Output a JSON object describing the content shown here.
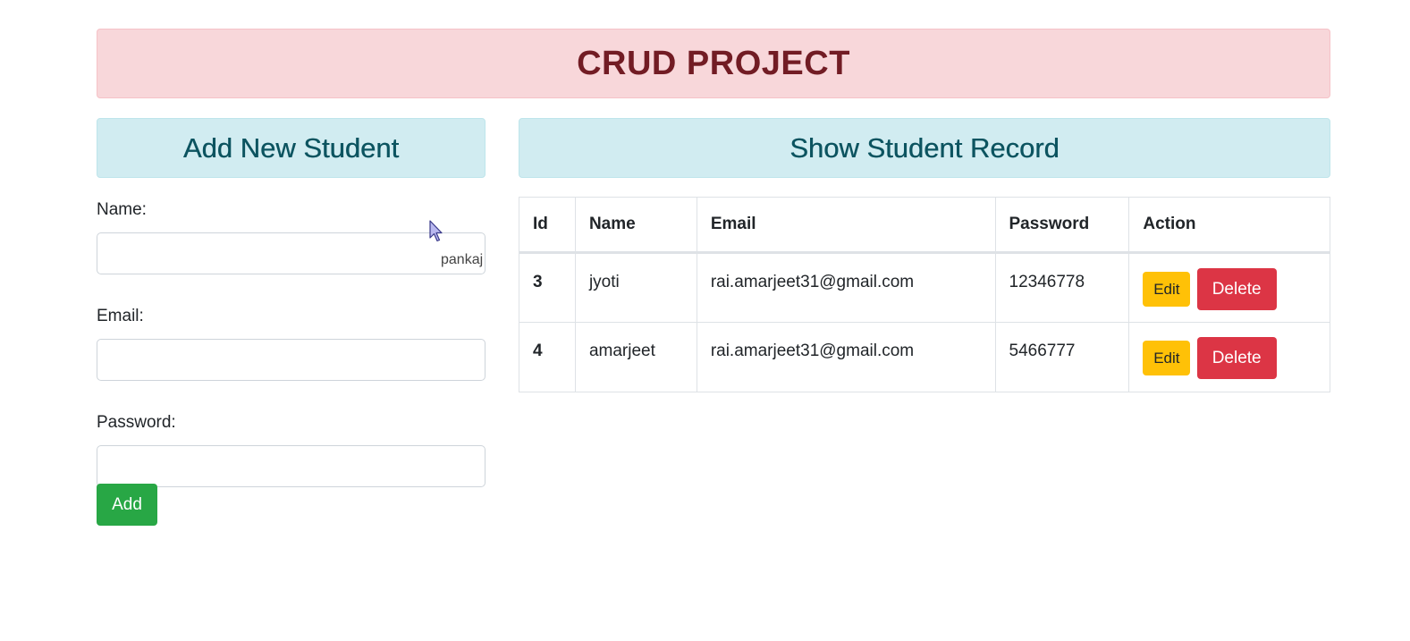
{
  "banner": {
    "title": "CRUD PROJECT"
  },
  "form": {
    "header": "Add New Student",
    "name_label": "Name:",
    "email_label": "Email:",
    "password_label": "Password:",
    "name_value": "",
    "email_value": "",
    "password_value": "",
    "autofill_hint": "pankaj",
    "add_label": "Add"
  },
  "records": {
    "header": "Show Student Record",
    "columns": [
      "Id",
      "Name",
      "Email",
      "Password",
      "Action"
    ],
    "rows": [
      {
        "id": "3",
        "name": "jyoti",
        "email": "rai.amarjeet31@gmail.com",
        "password": "12346778",
        "edit_label": "Edit",
        "delete_label": "Delete"
      },
      {
        "id": "4",
        "name": "amarjeet",
        "email": "rai.amarjeet31@gmail.com",
        "password": "5466777",
        "edit_label": "Edit",
        "delete_label": "Delete"
      }
    ]
  },
  "colors": {
    "banner_bg": "#f8d7da",
    "banner_text": "#721c24",
    "section_bg": "#d1ecf1",
    "section_text": "#0c5460",
    "add_button": "#28a745",
    "edit_button": "#ffc107",
    "delete_button": "#dc3545"
  },
  "icons": {
    "cursor": "mouse-pointer-icon"
  }
}
